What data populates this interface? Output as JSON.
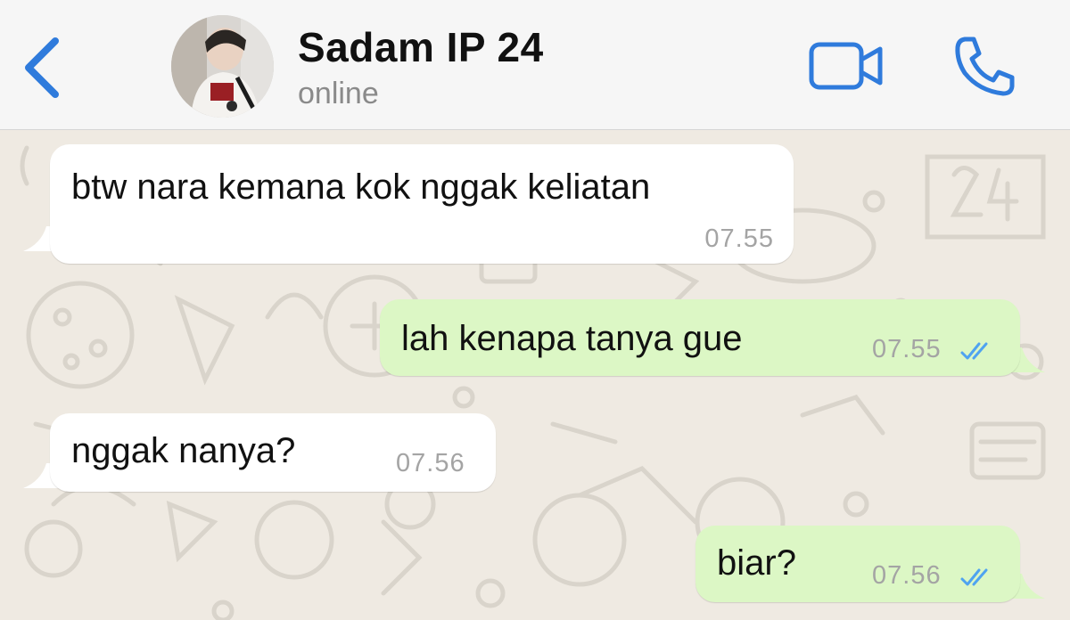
{
  "contact": {
    "name": "Sadam IP 24",
    "status": "online"
  },
  "colors": {
    "accent": "#2f7bdc",
    "header_bg": "#f6f6f6",
    "chat_bg": "#efeae2",
    "incoming_bubble": "#ffffff",
    "outgoing_bubble": "#dcf7c5",
    "read_ticks": "#4fa3f0"
  },
  "icons": {
    "back": "chevron-left-icon",
    "video": "video-camera-icon",
    "call": "phone-icon",
    "read_status": "double-check-icon"
  },
  "messages": [
    {
      "direction": "incoming",
      "text": "btw nara kemana kok nggak keliatan",
      "time": "07.55"
    },
    {
      "direction": "outgoing",
      "text": "lah kenapa tanya gue",
      "time": "07.55",
      "read": true
    },
    {
      "direction": "incoming",
      "text": "nggak nanya?",
      "time": "07.56"
    },
    {
      "direction": "outgoing",
      "text": "biar?",
      "time": "07.56",
      "read": true
    }
  ]
}
